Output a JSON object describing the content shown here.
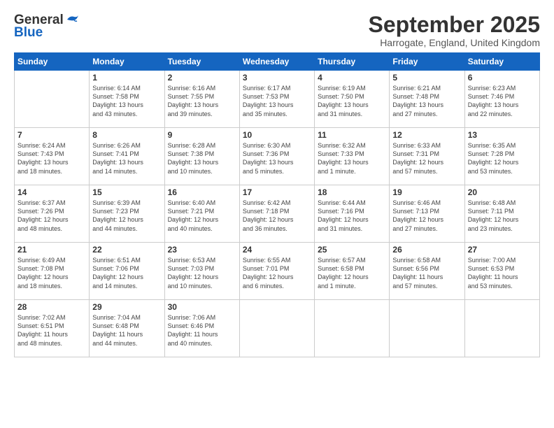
{
  "header": {
    "logo_general": "General",
    "logo_blue": "Blue",
    "month": "September 2025",
    "location": "Harrogate, England, United Kingdom"
  },
  "weekdays": [
    "Sunday",
    "Monday",
    "Tuesday",
    "Wednesday",
    "Thursday",
    "Friday",
    "Saturday"
  ],
  "weeks": [
    [
      {
        "day": "",
        "info": ""
      },
      {
        "day": "1",
        "info": "Sunrise: 6:14 AM\nSunset: 7:58 PM\nDaylight: 13 hours\nand 43 minutes."
      },
      {
        "day": "2",
        "info": "Sunrise: 6:16 AM\nSunset: 7:55 PM\nDaylight: 13 hours\nand 39 minutes."
      },
      {
        "day": "3",
        "info": "Sunrise: 6:17 AM\nSunset: 7:53 PM\nDaylight: 13 hours\nand 35 minutes."
      },
      {
        "day": "4",
        "info": "Sunrise: 6:19 AM\nSunset: 7:50 PM\nDaylight: 13 hours\nand 31 minutes."
      },
      {
        "day": "5",
        "info": "Sunrise: 6:21 AM\nSunset: 7:48 PM\nDaylight: 13 hours\nand 27 minutes."
      },
      {
        "day": "6",
        "info": "Sunrise: 6:23 AM\nSunset: 7:46 PM\nDaylight: 13 hours\nand 22 minutes."
      }
    ],
    [
      {
        "day": "7",
        "info": "Sunrise: 6:24 AM\nSunset: 7:43 PM\nDaylight: 13 hours\nand 18 minutes."
      },
      {
        "day": "8",
        "info": "Sunrise: 6:26 AM\nSunset: 7:41 PM\nDaylight: 13 hours\nand 14 minutes."
      },
      {
        "day": "9",
        "info": "Sunrise: 6:28 AM\nSunset: 7:38 PM\nDaylight: 13 hours\nand 10 minutes."
      },
      {
        "day": "10",
        "info": "Sunrise: 6:30 AM\nSunset: 7:36 PM\nDaylight: 13 hours\nand 5 minutes."
      },
      {
        "day": "11",
        "info": "Sunrise: 6:32 AM\nSunset: 7:33 PM\nDaylight: 13 hours\nand 1 minute."
      },
      {
        "day": "12",
        "info": "Sunrise: 6:33 AM\nSunset: 7:31 PM\nDaylight: 12 hours\nand 57 minutes."
      },
      {
        "day": "13",
        "info": "Sunrise: 6:35 AM\nSunset: 7:28 PM\nDaylight: 12 hours\nand 53 minutes."
      }
    ],
    [
      {
        "day": "14",
        "info": "Sunrise: 6:37 AM\nSunset: 7:26 PM\nDaylight: 12 hours\nand 48 minutes."
      },
      {
        "day": "15",
        "info": "Sunrise: 6:39 AM\nSunset: 7:23 PM\nDaylight: 12 hours\nand 44 minutes."
      },
      {
        "day": "16",
        "info": "Sunrise: 6:40 AM\nSunset: 7:21 PM\nDaylight: 12 hours\nand 40 minutes."
      },
      {
        "day": "17",
        "info": "Sunrise: 6:42 AM\nSunset: 7:18 PM\nDaylight: 12 hours\nand 36 minutes."
      },
      {
        "day": "18",
        "info": "Sunrise: 6:44 AM\nSunset: 7:16 PM\nDaylight: 12 hours\nand 31 minutes."
      },
      {
        "day": "19",
        "info": "Sunrise: 6:46 AM\nSunset: 7:13 PM\nDaylight: 12 hours\nand 27 minutes."
      },
      {
        "day": "20",
        "info": "Sunrise: 6:48 AM\nSunset: 7:11 PM\nDaylight: 12 hours\nand 23 minutes."
      }
    ],
    [
      {
        "day": "21",
        "info": "Sunrise: 6:49 AM\nSunset: 7:08 PM\nDaylight: 12 hours\nand 18 minutes."
      },
      {
        "day": "22",
        "info": "Sunrise: 6:51 AM\nSunset: 7:06 PM\nDaylight: 12 hours\nand 14 minutes."
      },
      {
        "day": "23",
        "info": "Sunrise: 6:53 AM\nSunset: 7:03 PM\nDaylight: 12 hours\nand 10 minutes."
      },
      {
        "day": "24",
        "info": "Sunrise: 6:55 AM\nSunset: 7:01 PM\nDaylight: 12 hours\nand 6 minutes."
      },
      {
        "day": "25",
        "info": "Sunrise: 6:57 AM\nSunset: 6:58 PM\nDaylight: 12 hours\nand 1 minute."
      },
      {
        "day": "26",
        "info": "Sunrise: 6:58 AM\nSunset: 6:56 PM\nDaylight: 11 hours\nand 57 minutes."
      },
      {
        "day": "27",
        "info": "Sunrise: 7:00 AM\nSunset: 6:53 PM\nDaylight: 11 hours\nand 53 minutes."
      }
    ],
    [
      {
        "day": "28",
        "info": "Sunrise: 7:02 AM\nSunset: 6:51 PM\nDaylight: 11 hours\nand 48 minutes."
      },
      {
        "day": "29",
        "info": "Sunrise: 7:04 AM\nSunset: 6:48 PM\nDaylight: 11 hours\nand 44 minutes."
      },
      {
        "day": "30",
        "info": "Sunrise: 7:06 AM\nSunset: 6:46 PM\nDaylight: 11 hours\nand 40 minutes."
      },
      {
        "day": "",
        "info": ""
      },
      {
        "day": "",
        "info": ""
      },
      {
        "day": "",
        "info": ""
      },
      {
        "day": "",
        "info": ""
      }
    ]
  ]
}
